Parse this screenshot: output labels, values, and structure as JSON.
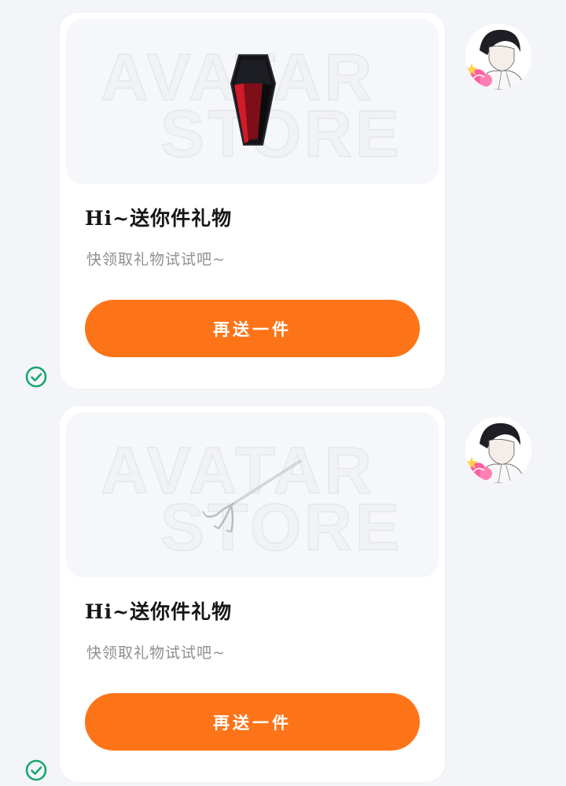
{
  "messages": [
    {
      "title": "Hi~送你件礼物",
      "subtitle": "快领取礼物试试吧~",
      "button_label": "再送一件",
      "watermark_top": "AVATAR",
      "watermark_bottom": "STORE",
      "gift_icon": "coffin-icon",
      "status_icon": "check-circle-icon"
    },
    {
      "title": "Hi~送你件礼物",
      "subtitle": "快领取礼物试试吧~",
      "button_label": "再送一件",
      "watermark_top": "AVATAR",
      "watermark_bottom": "STORE",
      "gift_icon": "trident-icon",
      "status_icon": "check-circle-icon"
    }
  ],
  "colors": {
    "button": "#fd7418",
    "status_check": "#1aa66f",
    "background": "#f3f5f8"
  }
}
